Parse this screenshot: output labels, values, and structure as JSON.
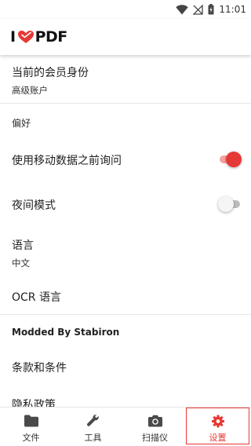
{
  "status_bar": {
    "time": "11:01"
  },
  "app_bar": {
    "logo_left": "I",
    "logo_right": "PDF"
  },
  "settings": {
    "membership": {
      "title": "当前的会员身份",
      "value": "高级账户"
    },
    "preferences_header": "偏好",
    "mobile_data": {
      "label": "使用移动数据之前询问",
      "enabled": true
    },
    "night_mode": {
      "label": "夜间模式",
      "enabled": false
    },
    "language": {
      "title": "语言",
      "value": "中文"
    },
    "ocr_language": "OCR 语言",
    "modded_header": "Modded By Stabiron",
    "terms": "条款和条件",
    "privacy": "隐私政策"
  },
  "bottom_nav": {
    "items": [
      {
        "label": "文件",
        "icon": "folder-icon"
      },
      {
        "label": "工具",
        "icon": "wrench-icon"
      },
      {
        "label": "扫描仪",
        "icon": "camera-icon"
      },
      {
        "label": "设置",
        "icon": "gear-icon"
      }
    ],
    "active_index": 3
  },
  "colors": {
    "accent": "#e53935",
    "toggle_track_on": "#f3a3a0",
    "toggle_off": "#bdbdbd"
  }
}
